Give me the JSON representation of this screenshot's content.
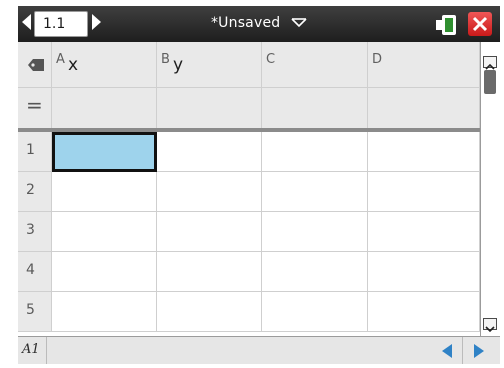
{
  "titlebar": {
    "page_tab": "1.1",
    "document_title": "*Unsaved",
    "prev_icon": "triangle-left-icon",
    "next_icon": "triangle-right-icon",
    "menu_icon": "chevron-down-icon",
    "battery_icon": "battery-icon",
    "close_icon": "close-icon"
  },
  "spreadsheet": {
    "columns": [
      {
        "letter": "A",
        "name": "x"
      },
      {
        "letter": "B",
        "name": "y"
      },
      {
        "letter": "C",
        "name": ""
      },
      {
        "letter": "D",
        "name": ""
      }
    ],
    "formula_row_symbol": "=",
    "rows": [
      "1",
      "2",
      "3",
      "4",
      "5"
    ],
    "selected_cell": {
      "column": "A",
      "row": "1"
    }
  },
  "entry_line": {
    "cell_reference": "A1",
    "value": ""
  },
  "colors": {
    "selection": "#9ed3ec",
    "nav_arrow": "#2f82c6",
    "close_button": "#d62222",
    "battery_level": "#2f8f2f"
  }
}
